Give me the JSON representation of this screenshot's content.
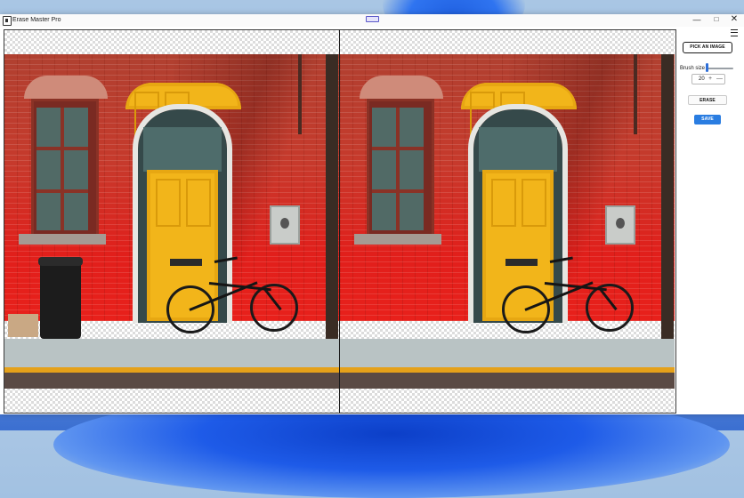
{
  "window": {
    "title": "Erase Master Pro",
    "controls": {
      "minimize": "—",
      "maximize": "□",
      "close": "✕"
    }
  },
  "toolbar": {
    "pick_image_label": "PICK AN IMAGE",
    "brush_size_label": "Brush size",
    "brush_size_value": "20",
    "brush_size_slider_fraction": 0.0,
    "erase_label": "ERASE",
    "save_label": "SAVE"
  },
  "icons": {
    "app": "app-icon",
    "menu": "hamburger-menu-icon",
    "increment": "plus-icon",
    "decrement": "minus-icon"
  },
  "colors": {
    "accent": "#2a7de1",
    "slider": "#2e6fd8"
  }
}
